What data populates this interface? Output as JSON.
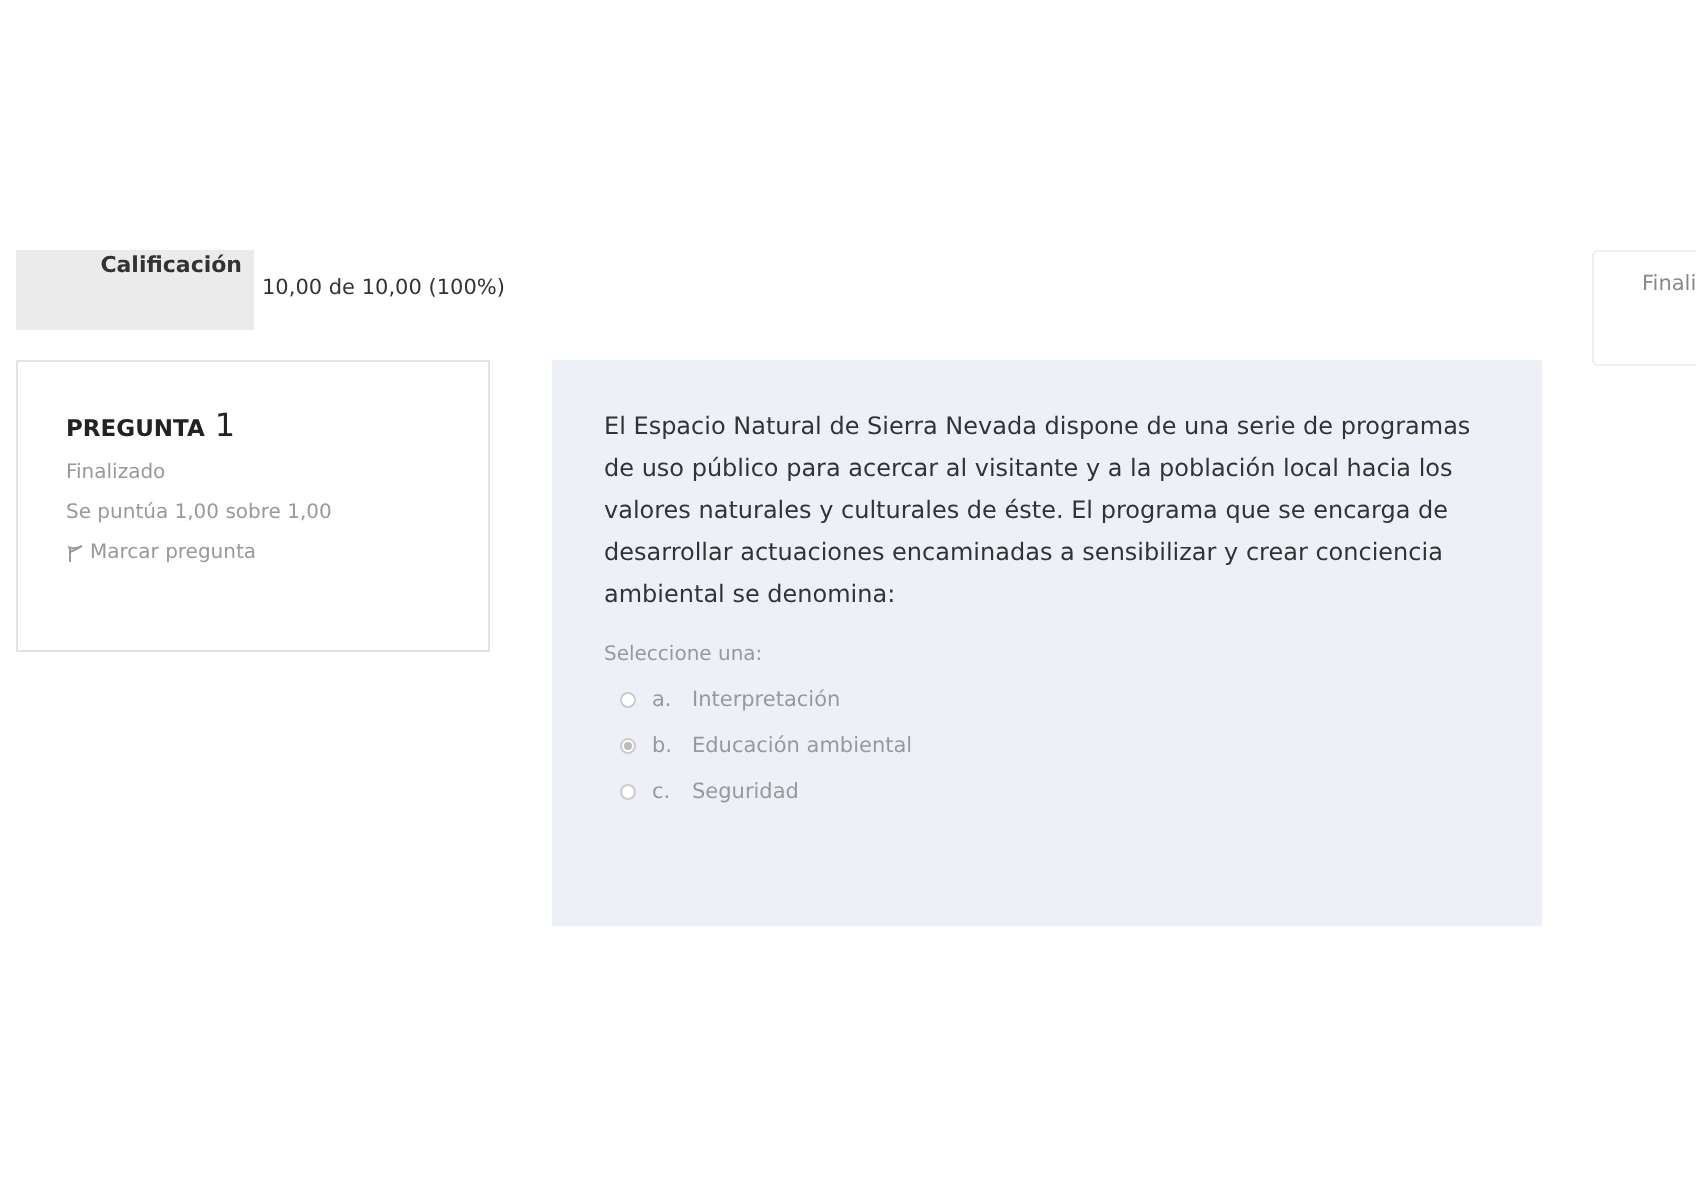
{
  "grade": {
    "label": "Calificación",
    "value": "10,00 de 10,00 (100%)"
  },
  "side_card": {
    "text": "Finali"
  },
  "question_info": {
    "heading": "PREGUNTA",
    "number": "1",
    "status": "Finalizado",
    "score": "Se puntúa 1,00 sobre 1,00",
    "flag_label": "Marcar pregunta"
  },
  "question": {
    "text": "El Espacio Natural de Sierra Nevada dispone de una serie de programas de uso público para acercar al visitante y a la población local hacia los valores naturales y culturales de éste. El programa que se encarga de desarrollar actuaciones encaminadas a sensibilizar y crear conciencia ambiental se denomina:",
    "prompt": "Seleccione una:",
    "options": [
      {
        "letter": "a.",
        "label": "Interpretación",
        "selected": false
      },
      {
        "letter": "b.",
        "label": "Educación ambiental",
        "selected": true
      },
      {
        "letter": "c.",
        "label": "Seguridad",
        "selected": false
      }
    ]
  }
}
